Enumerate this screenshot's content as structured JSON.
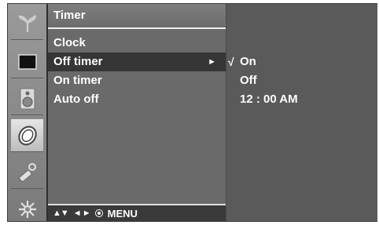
{
  "sidebar": {
    "icons": [
      {
        "name": "picture-icon"
      },
      {
        "name": "screen-icon"
      },
      {
        "name": "sound-icon"
      },
      {
        "name": "time-icon"
      },
      {
        "name": "option-icon"
      },
      {
        "name": "setup-icon"
      }
    ]
  },
  "menu": {
    "title": "Timer",
    "items": [
      {
        "label": "Clock"
      },
      {
        "label": "Off timer",
        "selected": true
      },
      {
        "label": "On timer"
      },
      {
        "label": "Auto off"
      }
    ],
    "selected_arrow": "►"
  },
  "submenu": {
    "items": [
      {
        "label": "On",
        "checked": true
      },
      {
        "label": "Off"
      },
      {
        "label": "12 : 00 AM"
      }
    ],
    "check_mark": "√"
  },
  "footer": {
    "updown": "▲▼",
    "leftright": "◄ ►",
    "menu_label": "MENU"
  },
  "colors": {
    "panel": "#6a6a6a",
    "highlight": "#363636",
    "text": "#ffffff"
  }
}
